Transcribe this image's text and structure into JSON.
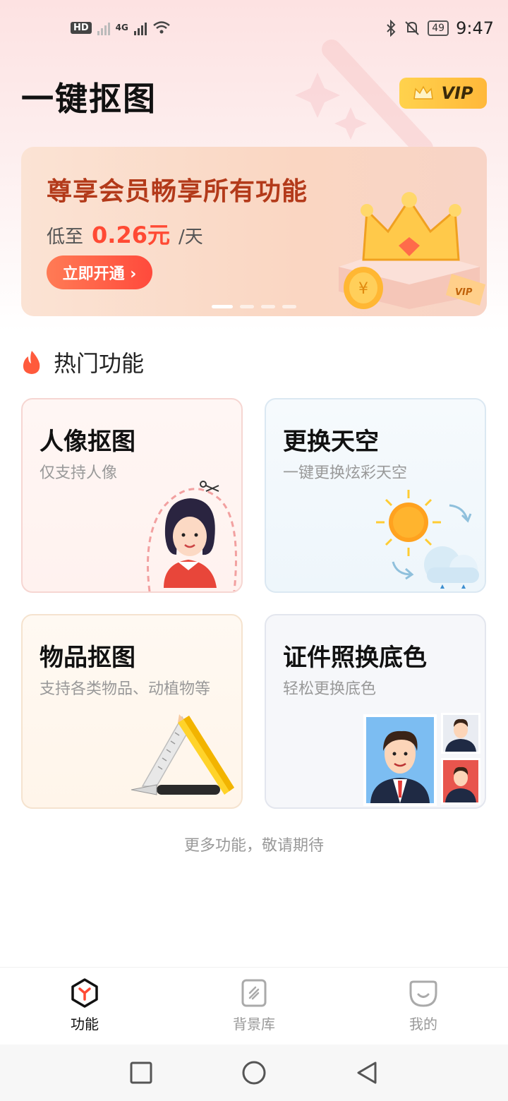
{
  "status_bar": {
    "hd_badge": "HD",
    "network": "4G",
    "battery": "49",
    "time": "9:47"
  },
  "header": {
    "title": "一键抠图",
    "vip_label": "VIP"
  },
  "banner": {
    "headline": "尊享会员畅享所有功能",
    "price_prefix": "低至",
    "price_value": "0.26元",
    "price_suffix": "/天",
    "cta": "立即开通 ›",
    "slide_count": 4,
    "active_slide": 1
  },
  "section": {
    "title": "热门功能"
  },
  "cards": [
    {
      "title": "人像抠图",
      "subtitle": "仅支持人像"
    },
    {
      "title": "更换天空",
      "subtitle": "一键更换炫彩天空"
    },
    {
      "title": "物品抠图",
      "subtitle": "支持各类物品、动植物等"
    },
    {
      "title": "证件照换底色",
      "subtitle": "轻松更换底色"
    }
  ],
  "more_text": "更多功能，敬请期待",
  "tabs": [
    {
      "label": "功能",
      "icon": "cube-icon",
      "active": true
    },
    {
      "label": "背景库",
      "icon": "background-library-icon",
      "active": false
    },
    {
      "label": "我的",
      "icon": "smile-face-icon",
      "active": false
    }
  ],
  "colors": {
    "accent": "#ff4a34",
    "vip_gold": "#ffc23f",
    "banner_title": "#b33a1a"
  }
}
